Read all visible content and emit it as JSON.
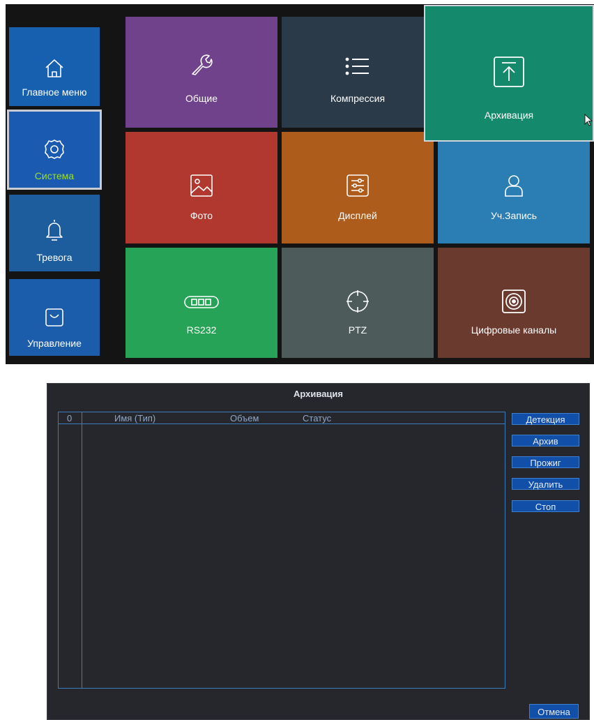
{
  "menu": {
    "sidebar": [
      {
        "key": "main",
        "label": "Главное меню",
        "icon": "home-icon"
      },
      {
        "key": "system",
        "label": "Система",
        "icon": "gear-icon",
        "selected": true
      },
      {
        "key": "alarm",
        "label": "Тревога",
        "icon": "bell-icon"
      },
      {
        "key": "manage",
        "label": "Управление",
        "icon": "bag-icon"
      }
    ],
    "tiles": [
      {
        "key": "general",
        "label": "Общие",
        "icon": "wrench-icon",
        "color": "#70428c"
      },
      {
        "key": "compression",
        "label": "Компрессия",
        "icon": "list-icon",
        "color": "#2a3a48"
      },
      {
        "key": "archive",
        "label": "Архивация",
        "icon": "upload-icon",
        "color": "#15896b",
        "highlighted": true
      },
      {
        "key": "photo",
        "label": "Фото",
        "icon": "image-icon",
        "color": "#b0382e"
      },
      {
        "key": "display",
        "label": "Дисплей",
        "icon": "sliders-icon",
        "color": "#ad5c1c"
      },
      {
        "key": "account",
        "label": "Уч.Запись",
        "icon": "user-icon",
        "color": "#2a7eb4"
      },
      {
        "key": "rs232",
        "label": "RS232",
        "icon": "serial-port-icon",
        "color": "#26a356"
      },
      {
        "key": "ptz",
        "label": "PTZ",
        "icon": "crosshair-icon",
        "color": "#4e5b5b"
      },
      {
        "key": "digital",
        "label": "Цифровые каналы",
        "icon": "speaker-icon",
        "color": "#6b3a2e"
      }
    ]
  },
  "archive_dialog": {
    "title": "Архивация",
    "table": {
      "columns": [
        "0",
        "Имя (Тип)",
        "Объем",
        "Статус"
      ],
      "rows": []
    },
    "buttons": {
      "detect": "Детекция",
      "archive": "Архив",
      "burn": "Прожиг",
      "delete": "Удалить",
      "stop": "Стоп",
      "cancel": "Отмена"
    }
  }
}
